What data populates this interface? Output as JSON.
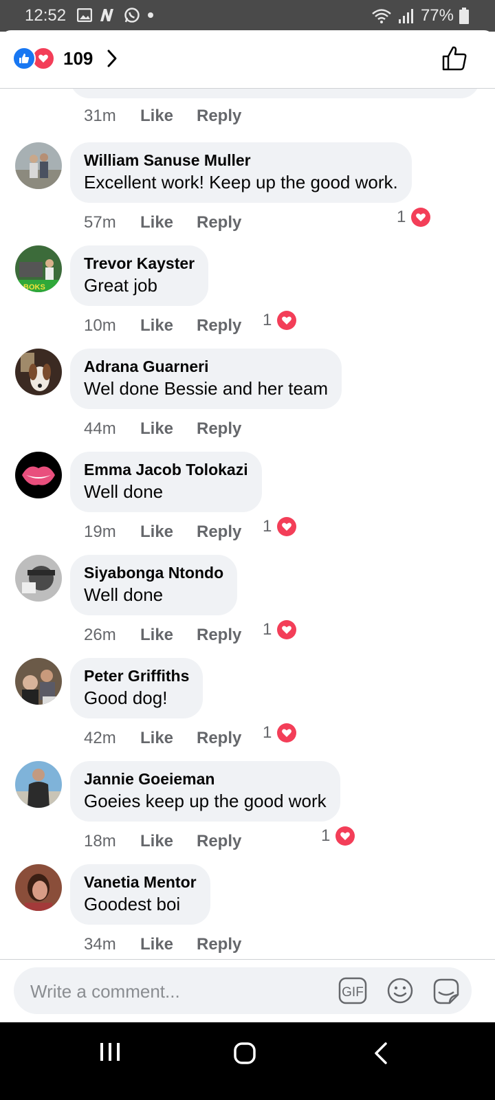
{
  "status_bar": {
    "time": "12:52",
    "battery": "77%"
  },
  "header": {
    "reaction_count": "109"
  },
  "previous_comment": {
    "time": "31m",
    "like": "Like",
    "reply": "Reply"
  },
  "comments": [
    {
      "author": "William Sanuse Muller",
      "text": "Excellent work! Keep up the good work.",
      "time": "57m",
      "like": "Like",
      "reply": "Reply",
      "reactions": "1"
    },
    {
      "author": "Trevor Kayster",
      "text": "Great job",
      "time": "10m",
      "like": "Like",
      "reply": "Reply",
      "reactions": "1",
      "avatar_label": "BOKS"
    },
    {
      "author": "Adrana Guarneri",
      "text": "Wel done Bessie and her team",
      "time": "44m",
      "like": "Like",
      "reply": "Reply"
    },
    {
      "author": "Emma Jacob Tolokazi",
      "text": "Well done",
      "time": "19m",
      "like": "Like",
      "reply": "Reply",
      "reactions": "1"
    },
    {
      "author": "Siyabonga Ntondo",
      "text": "Well done",
      "time": "26m",
      "like": "Like",
      "reply": "Reply",
      "reactions": "1"
    },
    {
      "author": "Peter Griffiths",
      "text": "Good dog!",
      "time": "42m",
      "like": "Like",
      "reply": "Reply",
      "reactions": "1"
    },
    {
      "author": "Jannie Goeieman",
      "text": "Goeies keep up the good work",
      "time": "18m",
      "like": "Like",
      "reply": "Reply",
      "reactions": "1"
    },
    {
      "author": "Vanetia Mentor",
      "text": "Goodest boi",
      "time": "34m",
      "like": "Like",
      "reply": "Reply"
    }
  ],
  "composer": {
    "placeholder": "Write a comment...",
    "gif_label": "GIF"
  },
  "colors": {
    "like_blue": "#1877f2",
    "love_red": "#f33e58",
    "bubble": "#f0f2f5",
    "meta_gray": "#65676b"
  }
}
